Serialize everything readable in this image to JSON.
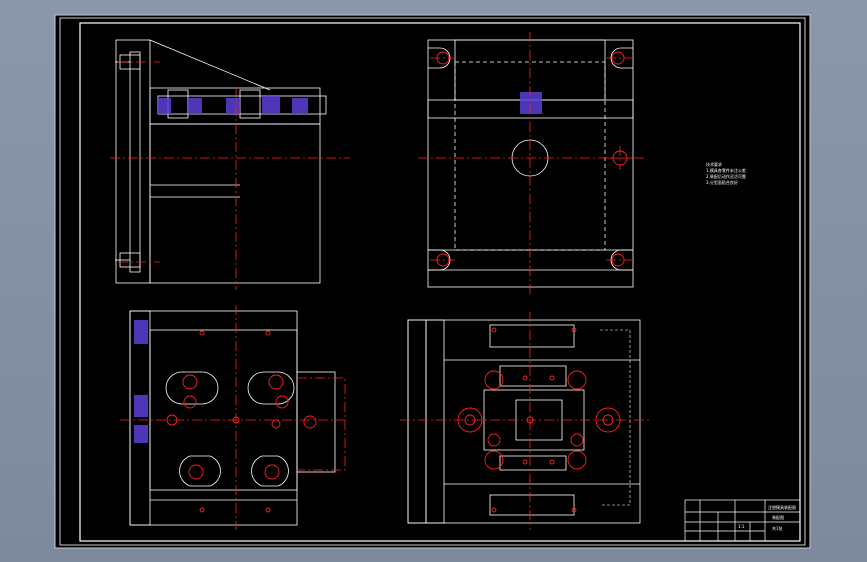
{
  "colors": {
    "background": "#8a97ab",
    "paper": "#000000",
    "line": "#ffffff",
    "centerline": "#ff1a1a",
    "hatch": "#6a4cff"
  },
  "drawing": {
    "views": [
      "front-section-view",
      "top-view",
      "side-view",
      "bottom-view"
    ],
    "tech_notes": {
      "line1": "技术要求",
      "line2": "1.模具各零件未注公差",
      "line3": "2.装配后动作灵活可靠",
      "line4": "3.分型面贴合良好"
    },
    "title_block": {
      "title": "注塑模具装配图",
      "subtitle": "装配图",
      "scale": "1:1",
      "sheet": "共1张"
    }
  }
}
